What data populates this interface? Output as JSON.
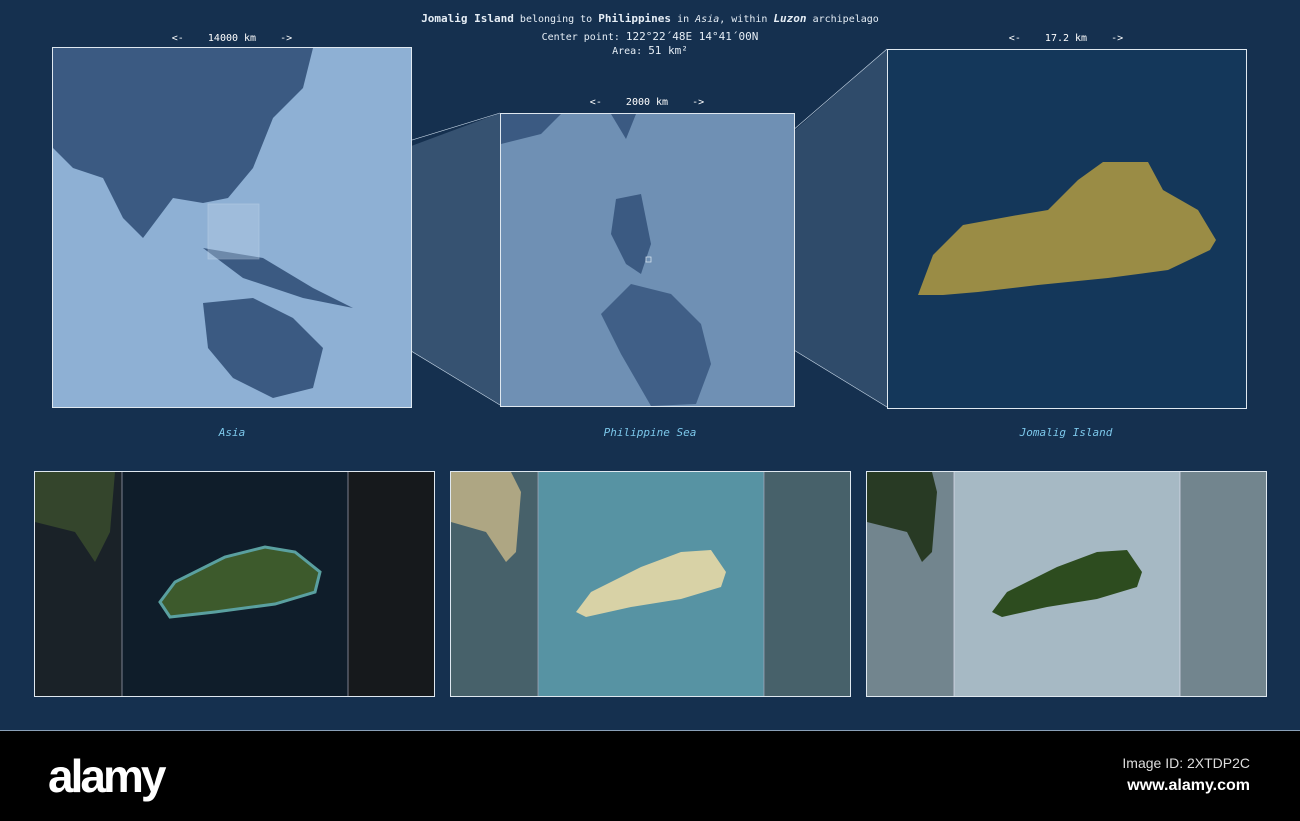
{
  "header": {
    "island": "Jomalig Island",
    "belonging": " belonging to ",
    "country": "Philippines",
    "in": " in ",
    "continent": "Asia",
    "within": ", within ",
    "archipelago": "Luzon",
    "archipelago_suffix": " archipelago",
    "center_label": "Center point: ",
    "center_value": "122°22´48E  14°41´00N",
    "area_label": "Area: ",
    "area_value": "51 km²"
  },
  "scales": {
    "asia": "<-    14000 km    ->",
    "region": "<-    2000 km    ->",
    "island": "<-    17.2 km    ->"
  },
  "labels": {
    "asia": "Asia",
    "region": "Philippine Sea",
    "island": "Jomalig Island"
  },
  "colors": {
    "background": "#15304f",
    "asia_sea": "#8eb0d4",
    "land": "#3b5a82",
    "island": "#9a8c45"
  },
  "footer": {
    "logo": "alamy",
    "image_id": "Image ID: 2XTDP2C",
    "url": "www.alamy.com"
  }
}
